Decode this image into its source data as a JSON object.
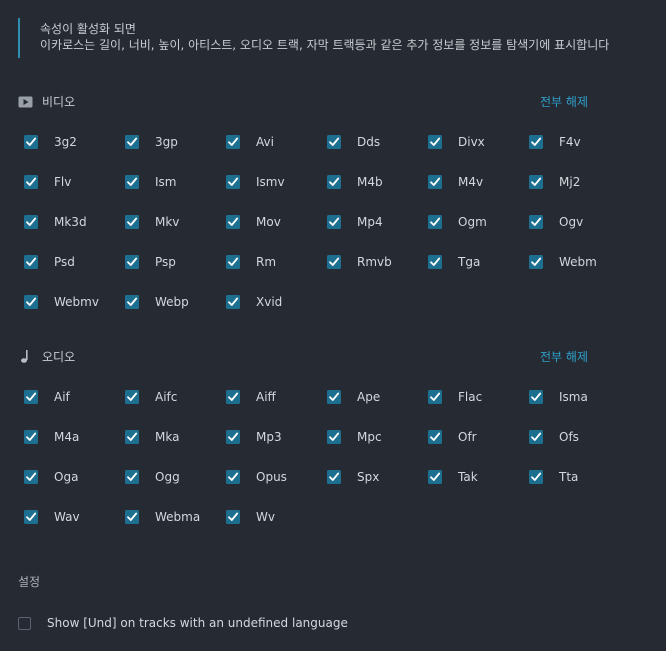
{
  "info": {
    "line1": "속성이 활성화 되면",
    "line2": "이카로스는 길이, 너비, 높이, 아티스트, 오디오 트랙, 자막 트랙등과 같은 추가 정보를 정보를 탐색기에 표시합니다"
  },
  "video": {
    "icon": "video-icon",
    "title": "비디오",
    "unselect_all": "전부 해제",
    "formats": [
      "3g2",
      "3gp",
      "Avi",
      "Dds",
      "Divx",
      "F4v",
      "Flv",
      "Ism",
      "Ismv",
      "M4b",
      "M4v",
      "Mj2",
      "Mk3d",
      "Mkv",
      "Mov",
      "Mp4",
      "Ogm",
      "Ogv",
      "Psd",
      "Psp",
      "Rm",
      "Rmvb",
      "Tga",
      "Webm",
      "Webmv",
      "Webp",
      "Xvid"
    ],
    "checked": true
  },
  "audio": {
    "icon": "music-note-icon",
    "title": "오디오",
    "unselect_all": "전부 해제",
    "formats": [
      "Aif",
      "Aifc",
      "Aiff",
      "Ape",
      "Flac",
      "Isma",
      "M4a",
      "Mka",
      "Mp3",
      "Mpc",
      "Ofr",
      "Ofs",
      "Oga",
      "Ogg",
      "Opus",
      "Spx",
      "Tak",
      "Tta",
      "Wav",
      "Webma",
      "Wv"
    ],
    "checked": true
  },
  "settings": {
    "title": "설정",
    "und_label": "Show [Und] on tracks with an undefined language",
    "und_checked": false
  },
  "colors": {
    "background": "#252a33",
    "accent": "#2f8fb3",
    "checkbox_fill": "#1d6f8f",
    "checkmark": "#ffffff",
    "link": "#2f9fc8"
  }
}
